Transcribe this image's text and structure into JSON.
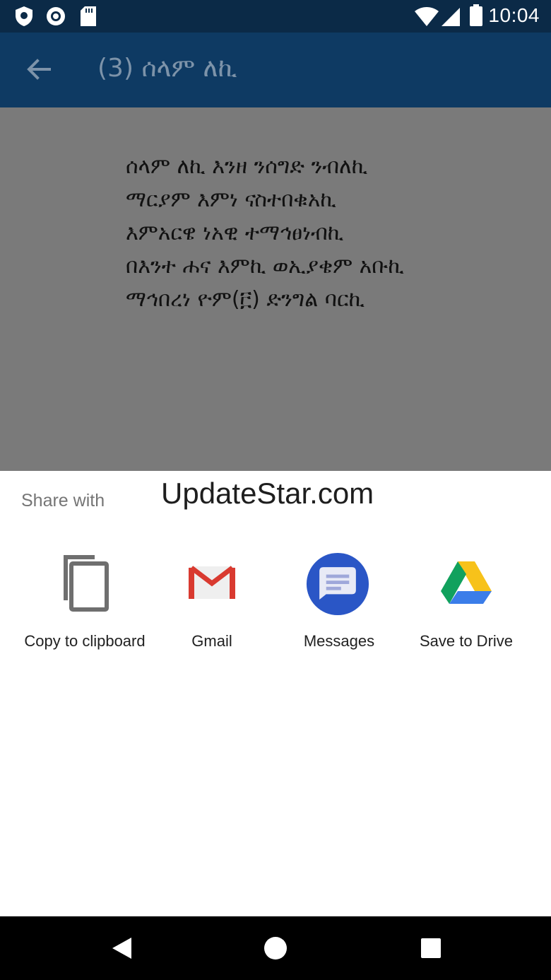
{
  "status_bar": {
    "time": "10:04",
    "icons": [
      "shield-icon",
      "record-icon",
      "sd-card-icon",
      "wifi-icon",
      "signal-icon",
      "battery-icon"
    ]
  },
  "app_bar": {
    "title": "(3) ሰላም ለኪ",
    "back_icon": "arrow-back-icon"
  },
  "content": {
    "lines": [
      "ሰላም ለኪ እንዘ ንሰግድ ንብለኪ",
      "ማርያም እምነ ናስተበቁአኪ",
      "እምአርዌ ነአዊ ተማኅፀነብኪ",
      "በእንተ ሐና እምኪ ወኢያቄም አቡኪ",
      "ማኅበረነ ዮም(፫) ድንግል ባርኪ"
    ]
  },
  "share_sheet": {
    "header": "Share with",
    "watermark": "UpdateStar.com",
    "targets": [
      {
        "label": "Copy to clipboard",
        "icon": "copy-icon"
      },
      {
        "label": "Gmail",
        "icon": "gmail-icon"
      },
      {
        "label": "Messages",
        "icon": "messages-icon"
      },
      {
        "label": "Save to Drive",
        "icon": "drive-icon"
      }
    ]
  },
  "nav_bar": {
    "buttons": [
      "back-triangle-icon",
      "home-circle-icon",
      "recents-square-icon"
    ]
  },
  "colors": {
    "status_bar": "#0b2a47",
    "app_bar": "#0e3a63",
    "scrim": "#7a7a7a",
    "sheet": "#ffffff",
    "messages_blue": "#2a56c6"
  }
}
